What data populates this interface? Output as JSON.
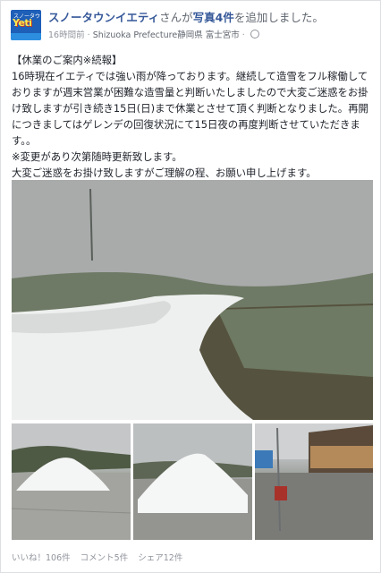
{
  "post": {
    "page_name": "スノータウンイエティ",
    "action_prefix": "さんが",
    "action_link": "写真4件",
    "action_suffix": "を追加しました。",
    "time": "16時間前",
    "separator": "·",
    "location_region": "Shizuoka Prefecture",
    "location_city": "静岡県 富士宮市",
    "avatar": {
      "top_text": "スノータウン",
      "logo_text": "Yeti"
    },
    "paragraphs": [
      "【休業のご案内※続報】\n16時現在イエティでは強い雨が降っております。継続して造雪をフル稼働しておりますが週末営業が困難な造雪量と判断いたしましたので大変ご迷惑をお掛け致しますが引き続き15日(日)まで休業とさせて頂く判断となりました。再開につきましてはゲレンデの回復状況にて15日夜の再度判断させていただきます。。\n※変更があり次第随時更新致します。",
      "大変ご迷惑をお掛け致しますがご理解の程、お願い申し上げます。"
    ],
    "photos": [
      "snow-slope-photo",
      "snow-pile-photo-1",
      "snow-pile-photo-2",
      "lodge-rain-photo"
    ],
    "stats": {
      "likes": "いいね！106件",
      "comments": "コメント5件",
      "shares": "シェア12件"
    }
  }
}
